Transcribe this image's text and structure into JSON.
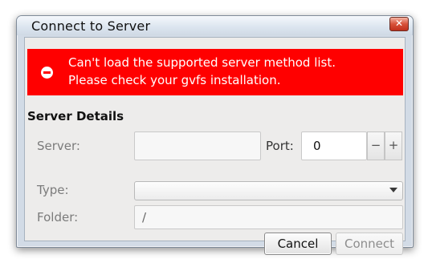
{
  "window": {
    "title": "Connect to Server",
    "close_label": "✕"
  },
  "error": {
    "icon": "error-circle-icon",
    "line1": "Can't load the supported server method list.",
    "line2": "Please check your gvfs installation.",
    "color": "#ff0000"
  },
  "details": {
    "heading": "Server Details",
    "server_label": "Server:",
    "server_value": "",
    "port_label": "Port:",
    "port_value": "0",
    "port_minus": "−",
    "port_plus": "+",
    "type_label": "Type:",
    "type_value": "",
    "folder_label": "Folder:",
    "folder_value": "/"
  },
  "buttons": {
    "cancel": "Cancel",
    "connect": "Connect"
  }
}
